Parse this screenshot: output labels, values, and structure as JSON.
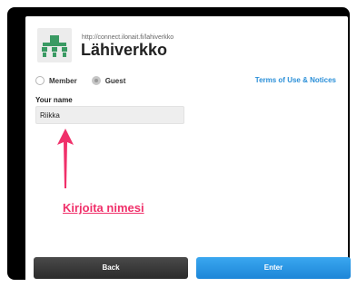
{
  "header": {
    "url": "http://connect.ilonait.fi/lahiverkko",
    "title": "Lähiverkko"
  },
  "user_type": {
    "member_label": "Member",
    "guest_label": "Guest",
    "selected": "Guest"
  },
  "terms_link": "Terms of Use & Notices",
  "name_field": {
    "label": "Your name",
    "value": "Riikka"
  },
  "annotation": {
    "text": "Kirjoita nimesi",
    "color": "#f0306a"
  },
  "buttons": {
    "back_label": "Back",
    "enter_label": "Enter"
  },
  "colors": {
    "accent": "#2a8fd8",
    "enter_button": "#1d86d8",
    "back_button": "#333333",
    "logo_green": "#3a9a63"
  }
}
